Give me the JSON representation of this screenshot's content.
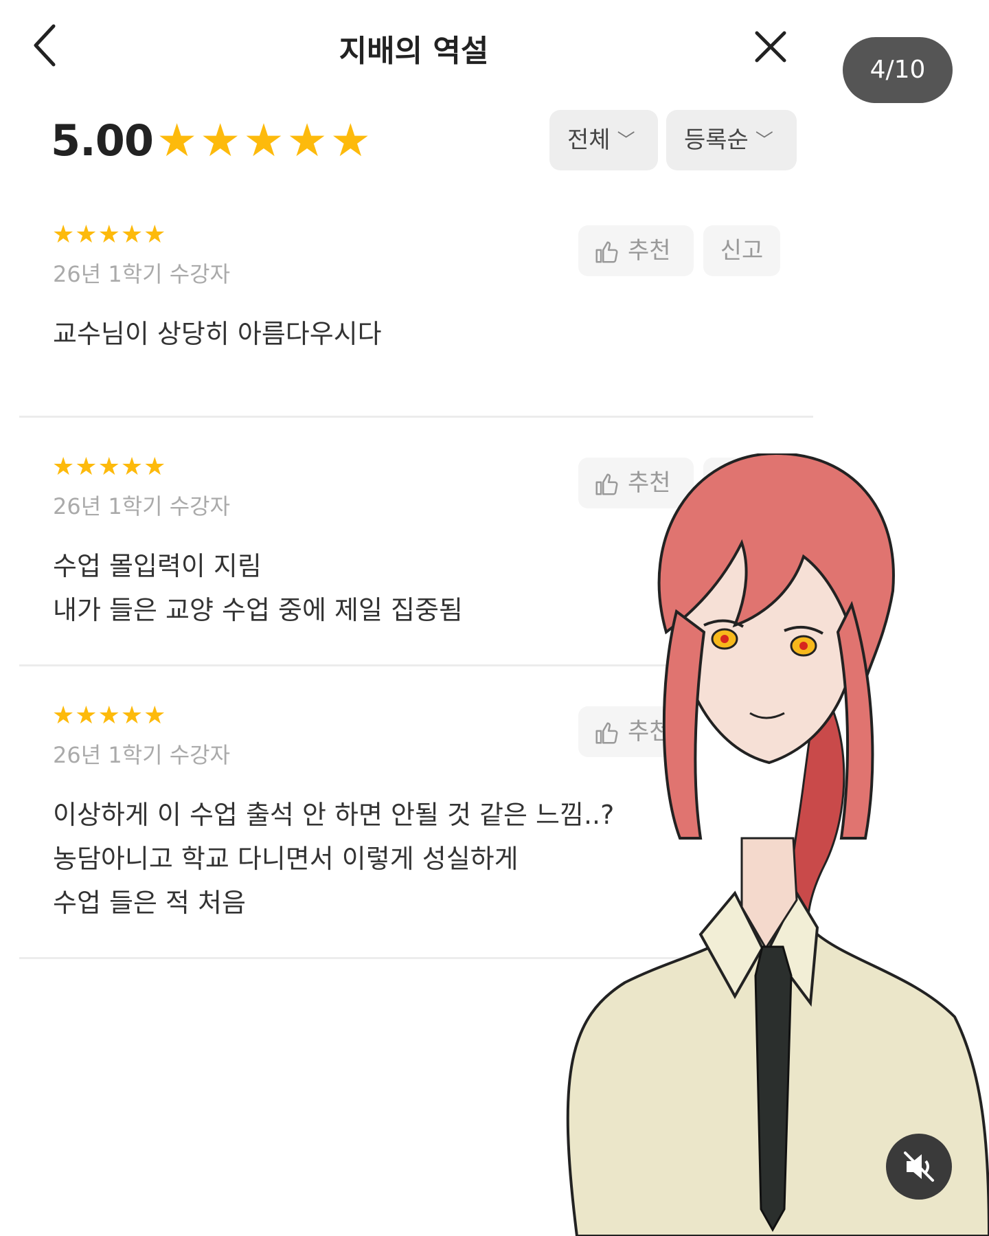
{
  "header": {
    "title": "지배의 역설"
  },
  "pager": {
    "label": "4/10"
  },
  "rating": {
    "score": "5.00",
    "stars": 5
  },
  "filters": {
    "scope_label": "전체",
    "sort_label": "등록순"
  },
  "review_actions": {
    "like_label": "추천",
    "report_label": "신고"
  },
  "reviews": [
    {
      "stars": 5,
      "semester": "26년 1학기 수강자",
      "lines": [
        "교수님이 상당히 아름다우시다"
      ]
    },
    {
      "stars": 5,
      "semester": "26년 1학기 수강자",
      "lines": [
        "수업 몰입력이 지림",
        "내가 들은 교양 수업 중에 제일 집중됨"
      ]
    },
    {
      "stars": 5,
      "semester": "26년 1학기 수강자",
      "lines": [
        "이상하게 이 수업 출석 안 하면 안될 것 같은 느낌..?",
        "농담아니고 학교 다니면서 이렇게 성실하게",
        "수업 들은 적 처음"
      ]
    }
  ],
  "icons": {
    "back": "chevron-left-icon",
    "close": "close-icon",
    "like": "thumbs-up-icon",
    "mute": "muted-speaker-icon",
    "star": "star-icon"
  },
  "colors": {
    "star": "#FDBA0C",
    "pager_bg": "#555555",
    "filter_bg": "#eeeeee",
    "button_bg": "#f5f5f5"
  }
}
